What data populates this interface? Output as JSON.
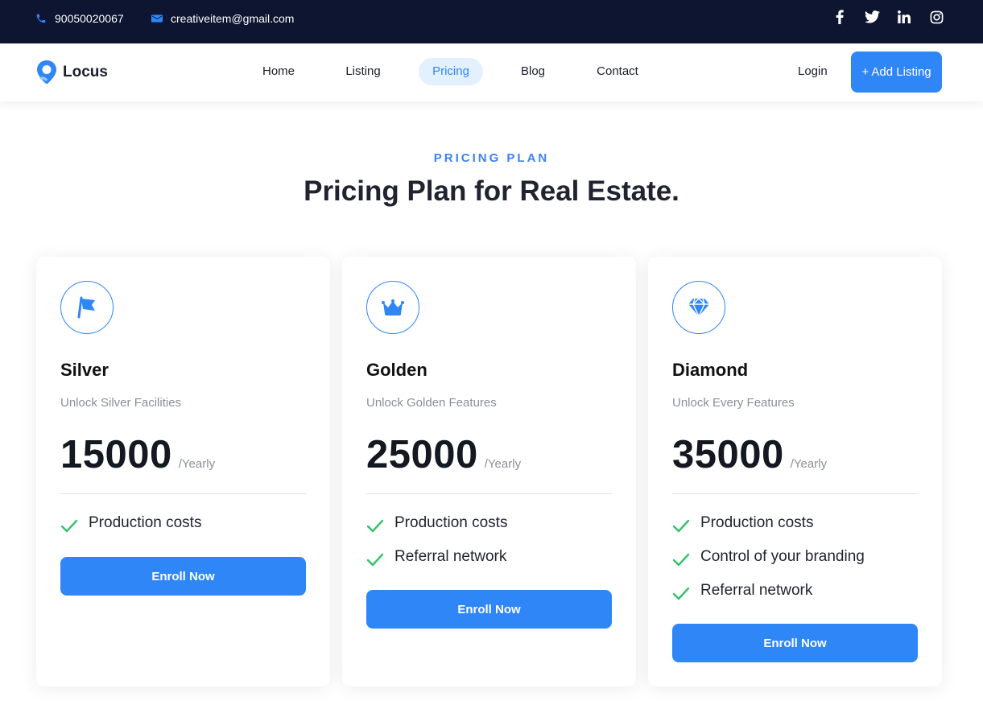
{
  "topbar": {
    "phone": "90050020067",
    "email": "creativeitem@gmail.com",
    "social": [
      "facebook-icon",
      "twitter-icon",
      "linkedin-icon",
      "instagram-icon"
    ]
  },
  "nav": {
    "brand": "Locus",
    "items": [
      {
        "label": "Home"
      },
      {
        "label": "Listing"
      },
      {
        "label": "Pricing",
        "active": true
      },
      {
        "label": "Blog"
      },
      {
        "label": "Contact"
      }
    ],
    "login": "Login",
    "add_listing": "+ Add Listing"
  },
  "section": {
    "kicker": "PRICING PLAN",
    "title": "Pricing Plan for Real Estate."
  },
  "plans": [
    {
      "icon": "flag-icon",
      "name": "Silver",
      "subtitle": "Unlock Silver Facilities",
      "price": "15000",
      "period": "/Yearly",
      "features": [
        "Production costs"
      ],
      "cta": "Enroll Now"
    },
    {
      "icon": "crown-icon",
      "name": "Golden",
      "subtitle": "Unlock Golden Features",
      "price": "25000",
      "period": "/Yearly",
      "features": [
        "Production costs",
        "Referral network"
      ],
      "cta": "Enroll Now"
    },
    {
      "icon": "diamond-icon",
      "name": "Diamond",
      "subtitle": "Unlock Every Features",
      "price": "35000",
      "period": "/Yearly",
      "features": [
        "Production costs",
        "Control of your branding",
        "Referral network"
      ],
      "cta": "Enroll Now"
    }
  ],
  "colors": {
    "topbar_bg": "#0d1530",
    "accent": "#2f86f7",
    "check": "#34c26b"
  }
}
